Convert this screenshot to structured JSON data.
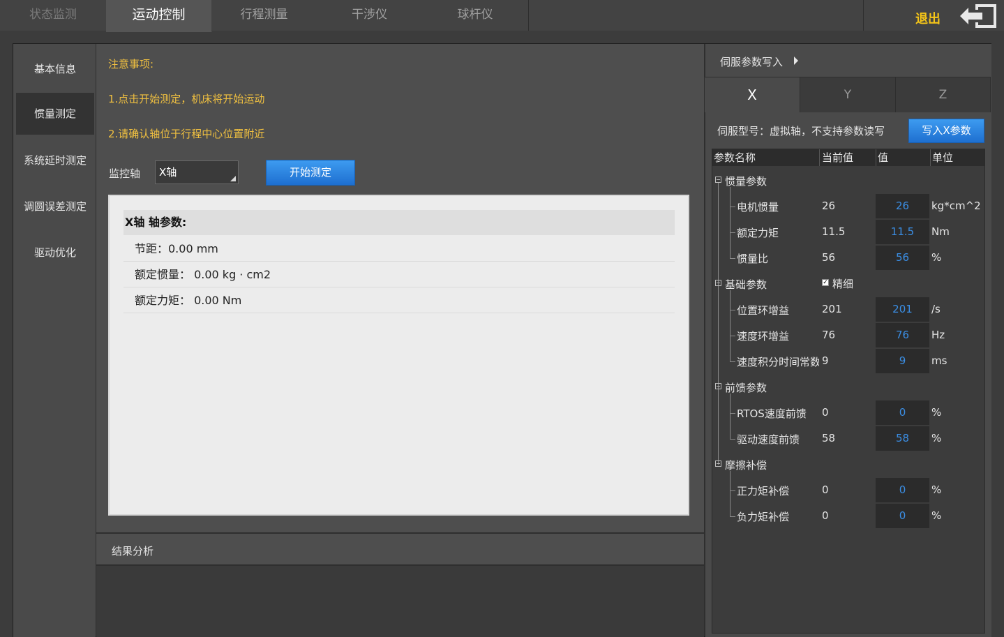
{
  "tabs": [
    {
      "label": "状态监测"
    },
    {
      "label": "运动控制"
    },
    {
      "label": "行程测量"
    },
    {
      "label": "干涉仪"
    },
    {
      "label": "球杆仪"
    }
  ],
  "exit_label": "退出",
  "nav": [
    {
      "label": "基本信息"
    },
    {
      "label": "惯量测定"
    },
    {
      "label": "系统延时测定"
    },
    {
      "label": "调圆误差测定"
    },
    {
      "label": "驱动优化"
    }
  ],
  "notes": {
    "title": "注意事项:",
    "line1": "1.点击开始测定，机床将开始运动",
    "line2": "2.请确认轴位于行程中心位置附近"
  },
  "monitor": {
    "label": "监控轴",
    "selected": "X轴",
    "start_button": "开始测定"
  },
  "axis_params": {
    "header": "X轴 轴参数:",
    "rows": [
      "节距：0.00 mm",
      "额定惯量：  0.00 kg · cm2",
      "额定力矩：  0.00 Nm"
    ]
  },
  "result_label": "结果分析",
  "servo": {
    "title": "伺服参数写入",
    "axis_tabs": [
      "X",
      "Y",
      "Z"
    ],
    "model_text": "伺服型号：虚拟轴，不支持参数读写",
    "write_button": "写入X参数",
    "columns": [
      "参数名称",
      "当前值",
      "值",
      "单位"
    ],
    "groups": {
      "inertia": "惯量参数",
      "basic": "基础参数",
      "feedforward": "前馈参数",
      "friction": "摩擦补偿"
    },
    "fine_label": "精细",
    "params": [
      {
        "name": "电机惯量",
        "current": "26",
        "value": "26",
        "unit": "kg*cm^2"
      },
      {
        "name": "额定力矩",
        "current": "11.5",
        "value": "11.5",
        "unit": "Nm"
      },
      {
        "name": "惯量比",
        "current": "56",
        "value": "56",
        "unit": "%"
      },
      {
        "name": "位置环增益",
        "current": "201",
        "value": "201",
        "unit": "/s"
      },
      {
        "name": "速度环增益",
        "current": "76",
        "value": "76",
        "unit": "Hz"
      },
      {
        "name": "速度积分时间常数",
        "current": "9",
        "value": "9",
        "unit": "ms"
      },
      {
        "name": "RTOS速度前馈",
        "current": "0",
        "value": "0",
        "unit": "%"
      },
      {
        "name": "驱动速度前馈",
        "current": "58",
        "value": "58",
        "unit": "%"
      },
      {
        "name": "正力矩补偿",
        "current": "0",
        "value": "0",
        "unit": "%"
      },
      {
        "name": "负力矩补偿",
        "current": "0",
        "value": "0",
        "unit": "%"
      }
    ]
  },
  "colors": {
    "accent_blue": "#1e6fd0",
    "warning_yellow": "#f0c040",
    "value_blue": "#3b8fe6"
  }
}
